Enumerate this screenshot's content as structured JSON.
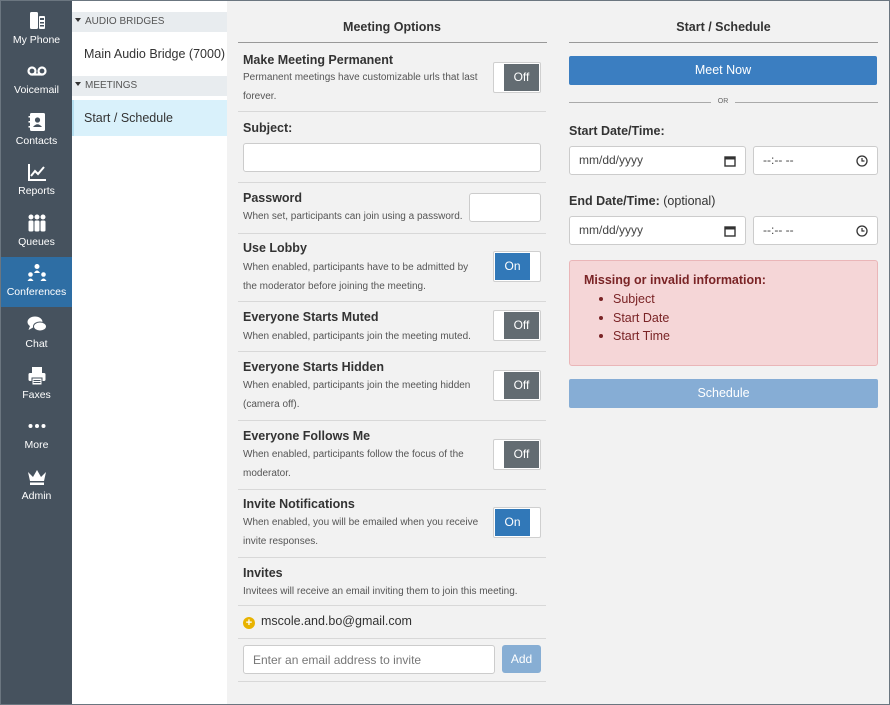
{
  "rail": {
    "items": [
      {
        "label": "My Phone",
        "icon": "phone-icon"
      },
      {
        "label": "Voicemail",
        "icon": "voicemail-icon"
      },
      {
        "label": "Contacts",
        "icon": "contacts-icon"
      },
      {
        "label": "Reports",
        "icon": "reports-icon"
      },
      {
        "label": "Queues",
        "icon": "queues-icon"
      },
      {
        "label": "Conferences",
        "icon": "conferences-icon",
        "active": true
      },
      {
        "label": "Chat",
        "icon": "chat-icon"
      },
      {
        "label": "Faxes",
        "icon": "fax-icon"
      },
      {
        "label": "More",
        "icon": "more-icon"
      },
      {
        "label": "Admin",
        "icon": "crown-icon"
      }
    ]
  },
  "subnav": {
    "audio_header": "AUDIO BRIDGES",
    "audio_item": "Main Audio Bridge (7000)",
    "meetings_header": "MEETINGS",
    "meetings_item": "Start / Schedule"
  },
  "options": {
    "title": "Meeting Options",
    "permanent": {
      "title": "Make Meeting Permanent",
      "desc": "Permanent meetings have customizable urls that last forever.",
      "state": "Off"
    },
    "subject": {
      "title": "Subject:",
      "value": ""
    },
    "password": {
      "title": "Password",
      "desc": "When set, participants can join using a password.",
      "value": ""
    },
    "lobby": {
      "title": "Use Lobby",
      "desc": "When enabled, participants have to be admitted by the moderator before joining the meeting.",
      "state": "On"
    },
    "muted": {
      "title": "Everyone Starts Muted",
      "desc": "When enabled, participants join the meeting muted.",
      "state": "Off"
    },
    "hidden": {
      "title": "Everyone Starts Hidden",
      "desc": "When enabled, participants join the meeting hidden (camera off).",
      "state": "Off"
    },
    "follows": {
      "title": "Everyone Follows Me",
      "desc": "When enabled, participants follow the focus of the moderator.",
      "state": "Off"
    },
    "notifications": {
      "title": "Invite Notifications",
      "desc": "When enabled, you will be emailed when you receive invite responses.",
      "state": "On"
    },
    "invites": {
      "title": "Invites",
      "desc": "Invitees will receive an email inviting them to join this meeting.",
      "list": [
        "mscole.and.bo@gmail.com"
      ],
      "placeholder": "Enter an email address to invite",
      "add_label": "Add"
    }
  },
  "schedule": {
    "title": "Start / Schedule",
    "meet_now": "Meet Now",
    "or": "OR",
    "start_label": "Start Date/Time:",
    "end_label": "End Date/Time:",
    "end_optional": "(optional)",
    "date_placeholder": "mm/dd/yyyy",
    "time_placeholder": "--:-- --",
    "alert_title": "Missing or invalid information:",
    "alert_items": [
      "Subject",
      "Start Date",
      "Start Time"
    ],
    "schedule_label": "Schedule"
  },
  "colors": {
    "rail": "#46525e",
    "rail_active": "#2e6ea4",
    "primary": "#3b7ec1",
    "toggle_off": "#636c72",
    "toggle_on": "#3178b8",
    "alert_bg": "#f5d6d7",
    "alert_text": "#7a2426"
  }
}
